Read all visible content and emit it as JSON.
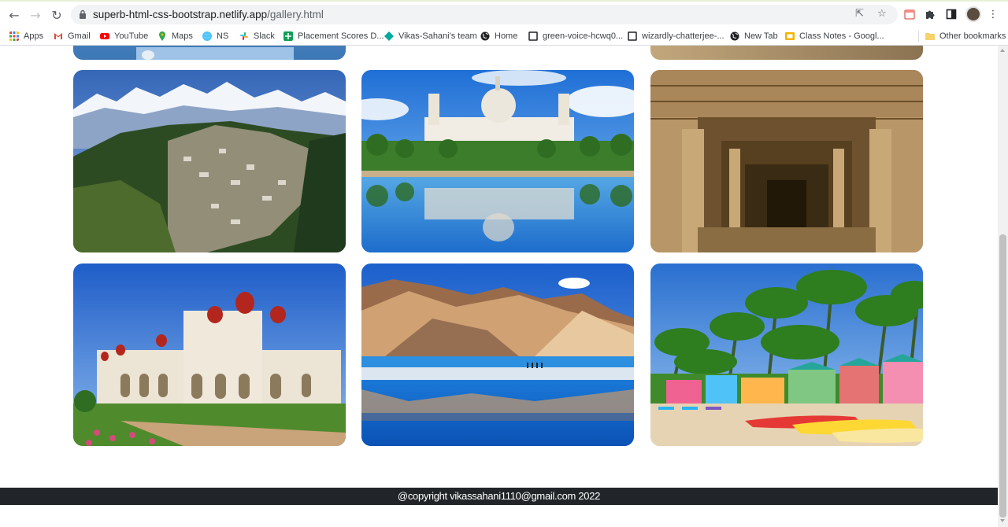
{
  "browser": {
    "url_host": "superb-html-css-bootstrap.netlify.app",
    "url_path": "/gallery.html"
  },
  "bookmarks": [
    {
      "label": "Apps",
      "icon": "apps-grid-icon",
      "color": "#ea4335"
    },
    {
      "label": "Gmail",
      "icon": "gmail-icon",
      "color": "#ea4335"
    },
    {
      "label": "YouTube",
      "icon": "youtube-icon",
      "color": "#ff0000"
    },
    {
      "label": "Maps",
      "icon": "maps-pin-icon",
      "color": "#34a853"
    },
    {
      "label": "NS",
      "icon": "globe-icon",
      "color": "#4fc3f7"
    },
    {
      "label": "Slack",
      "icon": "slack-icon",
      "color": "#e01e5a"
    },
    {
      "label": "Placement Scores D...",
      "icon": "sheets-icon",
      "color": "#0f9d58"
    },
    {
      "label": "Vikas-Sahani's team",
      "icon": "diamond-icon",
      "color": "#00a99d"
    },
    {
      "label": "Home",
      "icon": "globe-dark-icon",
      "color": "#202124"
    },
    {
      "label": "green-voice-hcwq0...",
      "icon": "square-outline-icon",
      "color": "#202124"
    },
    {
      "label": "wizardly-chatterjee-...",
      "icon": "square-outline-icon",
      "color": "#202124"
    },
    {
      "label": "New Tab",
      "icon": "globe-dark-icon",
      "color": "#202124"
    },
    {
      "label": "Class Notes - Googl...",
      "icon": "slides-icon",
      "color": "#f4b400"
    }
  ],
  "other_bookmarks": "Other bookmarks",
  "gallery": {
    "images": [
      {
        "name": "darjeeling-image"
      },
      {
        "name": "victoria-memorial-image"
      },
      {
        "name": "stepwell-image"
      },
      {
        "name": "mysore-palace-image"
      },
      {
        "name": "pangong-lake-image"
      },
      {
        "name": "goa-beach-image"
      }
    ]
  },
  "footer": {
    "text": "@copyright vikassahani1110@gmail.com 2022"
  }
}
